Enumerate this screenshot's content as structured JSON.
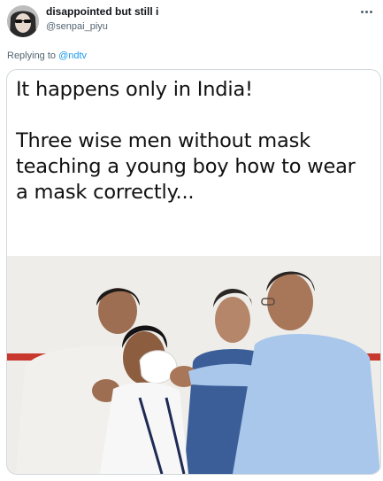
{
  "tweet": {
    "display_name": "disappointed but still i",
    "handle": "@senpai_piyu",
    "reply_prefix": "Replying to ",
    "reply_to": "@ndtv"
  },
  "media": {
    "line1": "It happens only in India!",
    "line2": "Three wise men without mask",
    "line3": "teaching a young boy  how to wear",
    "line4": "a mask correctly..."
  },
  "icons": {
    "more": "more-icon",
    "avatar": "avatar"
  },
  "colors": {
    "accent": "#1d9bf0",
    "secondary_text": "#536471",
    "border": "#cfd9de"
  }
}
